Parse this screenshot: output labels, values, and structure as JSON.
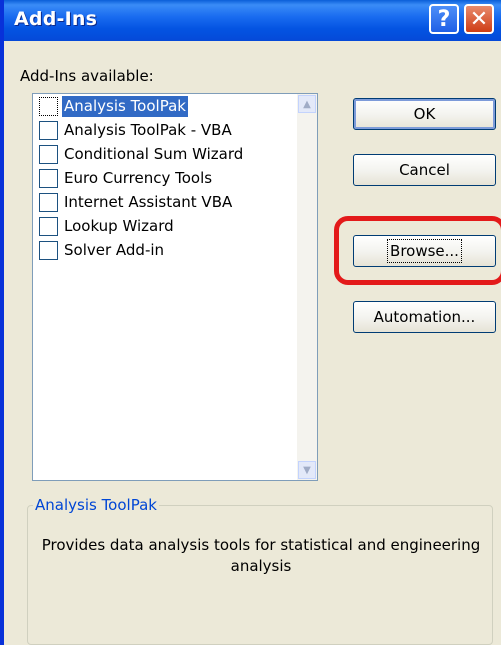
{
  "window": {
    "title": "Add-Ins",
    "help_icon": "?",
    "close_icon": "✕"
  },
  "addins": {
    "label": "Add-Ins available:",
    "items": [
      {
        "label": "Analysis ToolPak",
        "checked": false,
        "selected": true
      },
      {
        "label": "Analysis ToolPak - VBA",
        "checked": false,
        "selected": false
      },
      {
        "label": "Conditional Sum Wizard",
        "checked": false,
        "selected": false
      },
      {
        "label": "Euro Currency Tools",
        "checked": false,
        "selected": false
      },
      {
        "label": "Internet Assistant VBA",
        "checked": false,
        "selected": false
      },
      {
        "label": "Lookup Wizard",
        "checked": false,
        "selected": false
      },
      {
        "label": "Solver Add-in",
        "checked": false,
        "selected": false
      }
    ]
  },
  "buttons": {
    "ok": "OK",
    "cancel": "Cancel",
    "browse": "Browse...",
    "automation": "Automation..."
  },
  "description": {
    "title": "Analysis ToolPak",
    "text": "Provides data analysis tools for statistical and engineering analysis"
  },
  "colors": {
    "highlight": "#e31a1a",
    "selection": "#316ac5",
    "titlebar": "#0454e2"
  }
}
